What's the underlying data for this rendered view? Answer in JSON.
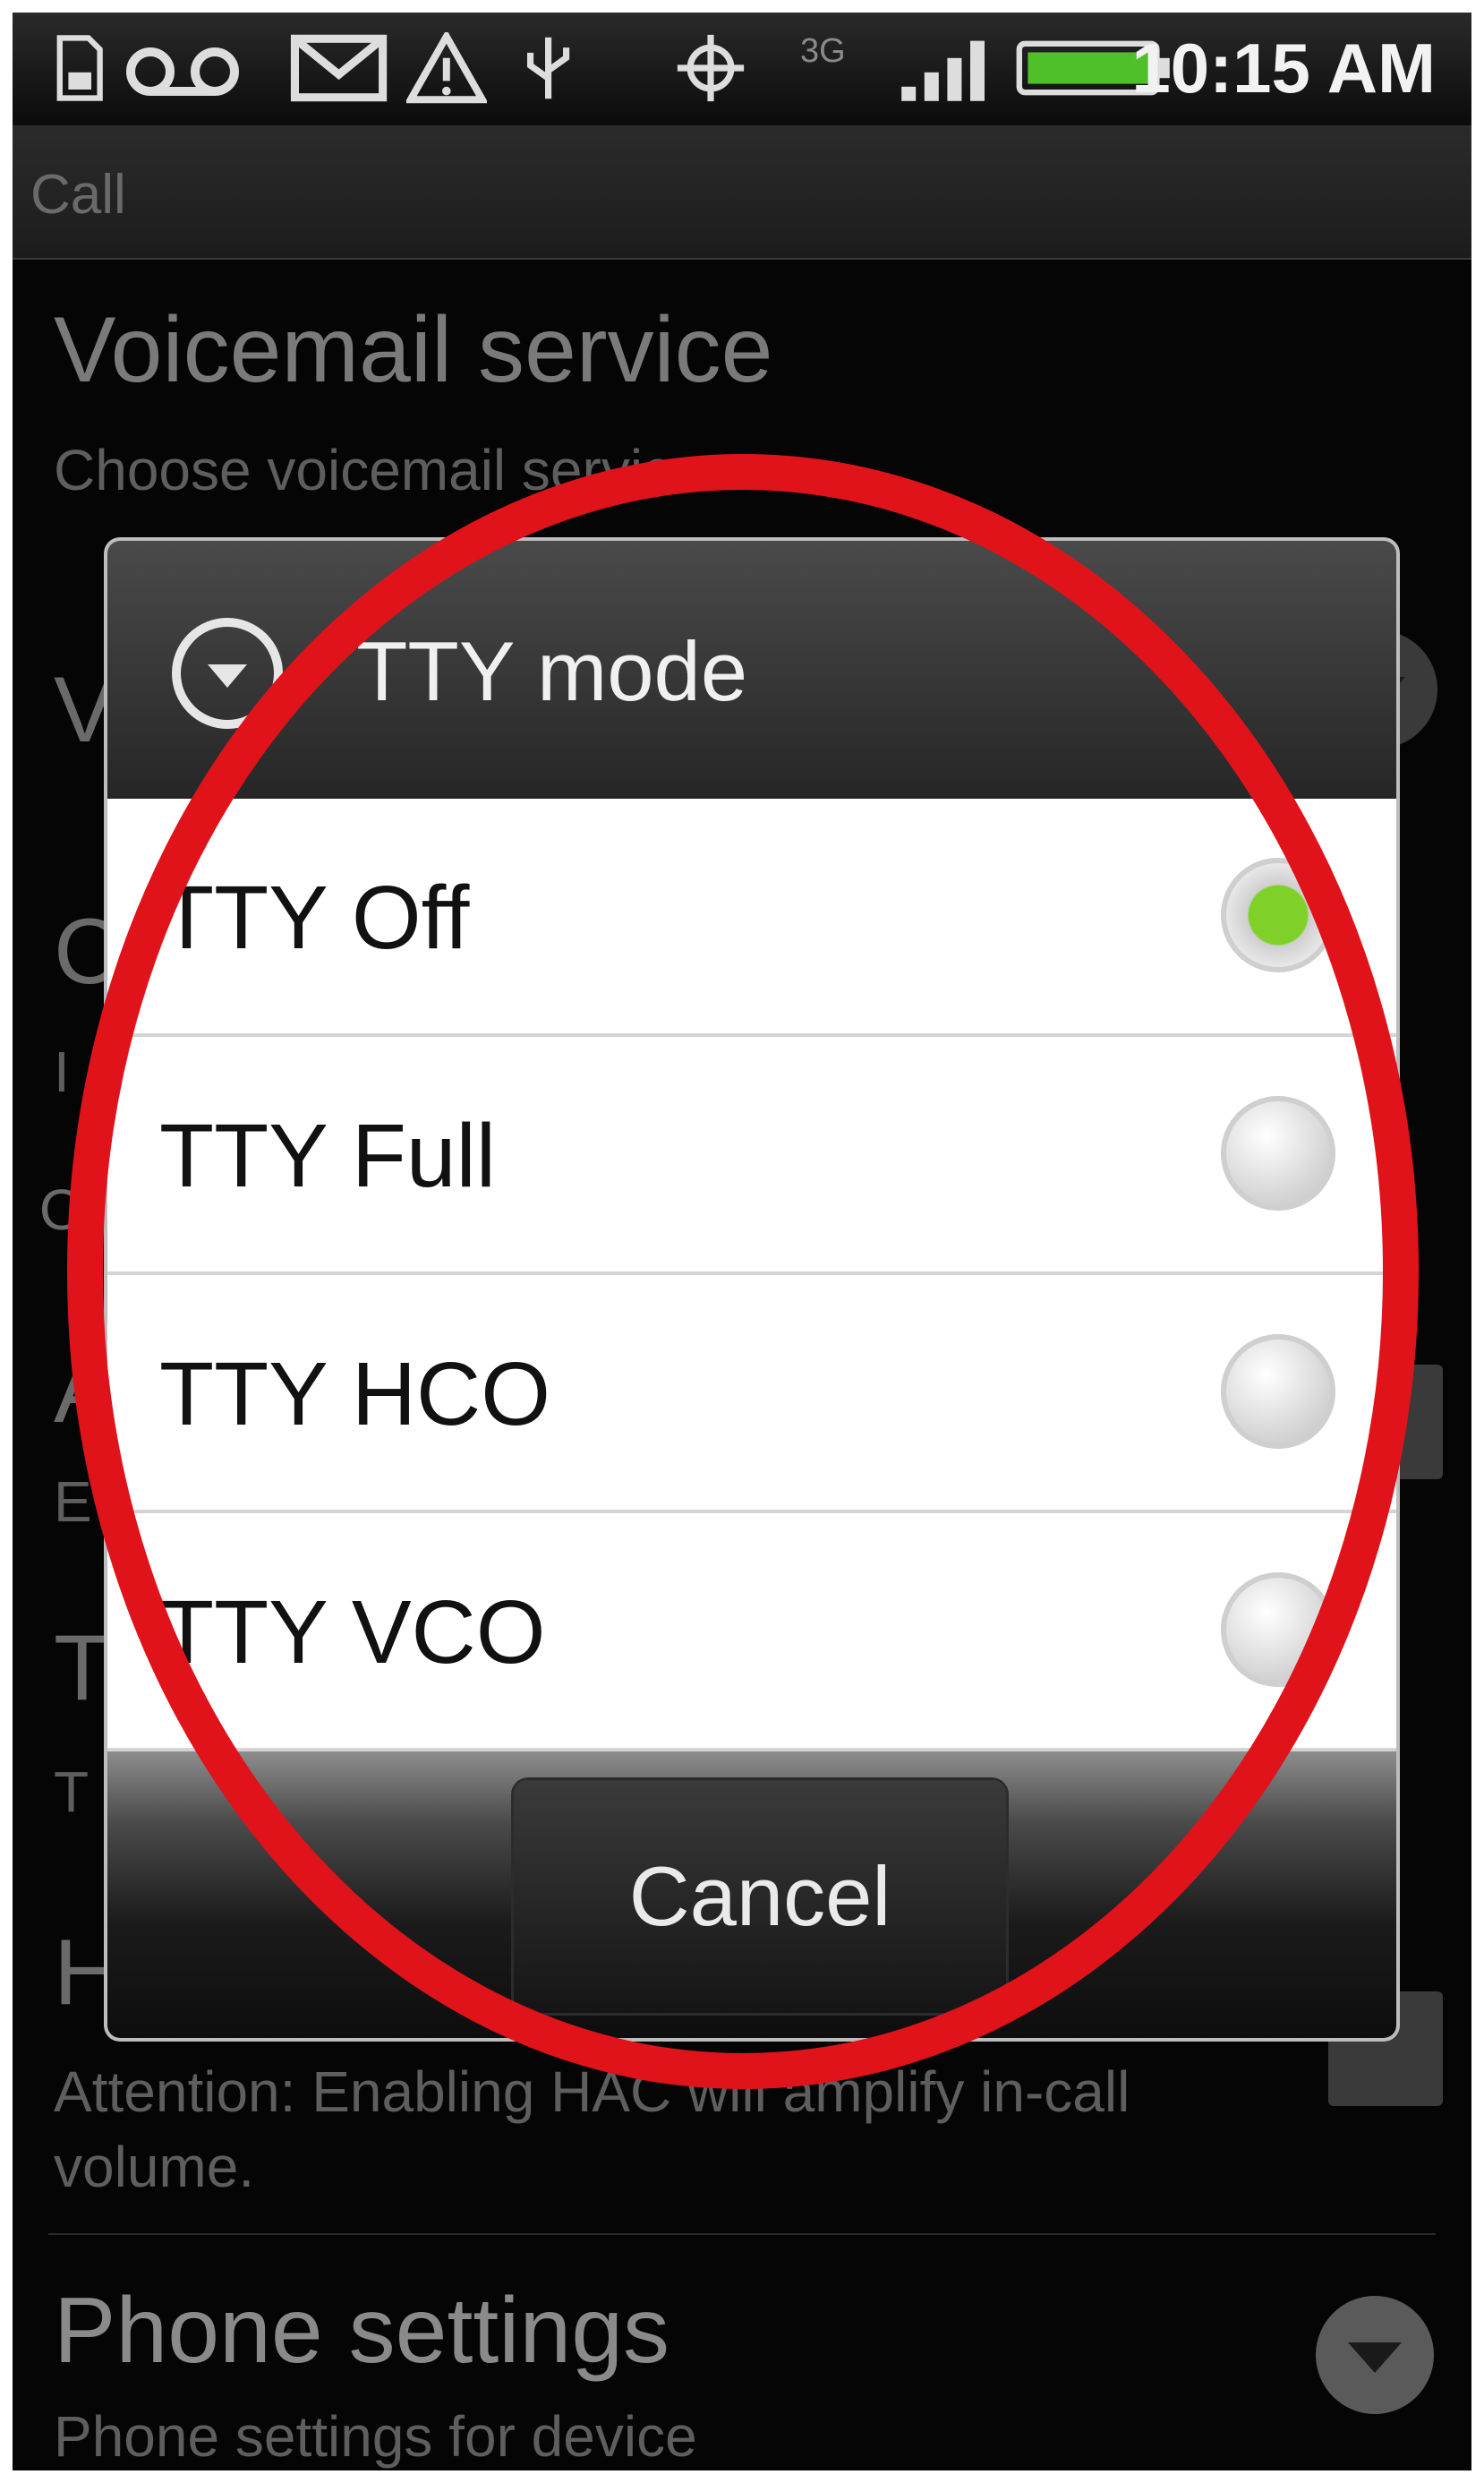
{
  "status_bar": {
    "time": "10:15 AM",
    "network_label": "3G",
    "icons": [
      "sd-card-icon",
      "voicemail-icon",
      "gmail-icon",
      "warning-icon",
      "usb-icon",
      "gps-icon",
      "signal-icon",
      "battery-icon"
    ]
  },
  "title_bar": {
    "title": "Call"
  },
  "background_list": {
    "voicemail_title": "Voicemail service",
    "voicemail_sub": "Choose voicemail service",
    "peek_v": "V",
    "peek_c": "C",
    "peek_i": "I",
    "peek_o": "O",
    "peek_a": "A",
    "peek_e": "E",
    "peek_t1": "T",
    "peek_t2": "T",
    "peek_h": "H",
    "hac_sub": "Attention: Enabling HAC will amplify in-call volume.",
    "phone_settings_title": "Phone settings",
    "phone_settings_sub": "Phone settings for device"
  },
  "dialog": {
    "title": "TTY mode",
    "options": [
      {
        "label": "TTY Off",
        "selected": true
      },
      {
        "label": "TTY Full",
        "selected": false
      },
      {
        "label": "TTY HCO",
        "selected": false
      },
      {
        "label": "TTY VCO",
        "selected": false
      }
    ],
    "cancel_label": "Cancel"
  },
  "colors": {
    "annotation_ring": "#e0131b",
    "radio_selected": "#7fd12a",
    "background": "#050505"
  }
}
